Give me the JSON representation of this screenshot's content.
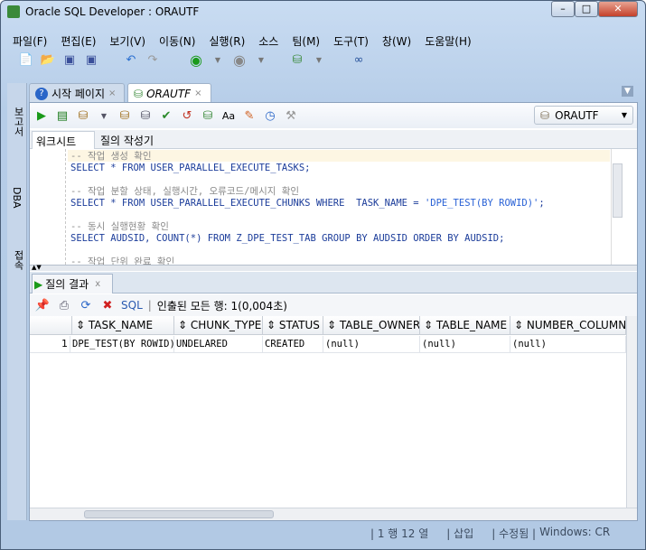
{
  "window": {
    "title": "Oracle SQL Developer : ORAUTF",
    "min": "–",
    "max": "□",
    "close": "✕"
  },
  "menu": [
    "파일(F)",
    "편집(E)",
    "보기(V)",
    "이동(N)",
    "실행(R)",
    "소스",
    "팀(M)",
    "도구(T)",
    "창(W)",
    "도움말(H)"
  ],
  "rail": {
    "reports": "보고서",
    "dba": "DBA",
    "connections": "접속"
  },
  "tabs": [
    {
      "label": "시작 페이지",
      "close": "×"
    },
    {
      "label": "ORAUTF",
      "close": "×"
    }
  ],
  "connection_select": "ORAUTF",
  "worksheet_tabs": [
    "워크시트",
    "질의 작성기"
  ],
  "editor_lines": [
    {
      "type": "comment",
      "text": "-- 작업 생성 확인"
    },
    {
      "type": "code",
      "text": "SELECT * FROM USER_PARALLEL_EXECUTE_TASKS;"
    },
    {
      "type": "code",
      "text": ""
    },
    {
      "type": "comment",
      "text": "-- 작업 분할 상태, 실행시간, 오류코드/메시지 확인"
    },
    {
      "type": "code",
      "text": "SELECT * FROM USER_PARALLEL_EXECUTE_CHUNKS WHERE  TASK_NAME = ",
      "str": "'DPE_TEST(BY ROWID)'",
      "tail": ";"
    },
    {
      "type": "code",
      "text": ""
    },
    {
      "type": "comment",
      "text": "-- 동시 실행현황 확인"
    },
    {
      "type": "code",
      "text": "SELECT AUDSID, COUNT(*) FROM Z_DPE_TEST_TAB GROUP BY AUDSID ORDER BY AUDSID;"
    },
    {
      "type": "code",
      "text": ""
    },
    {
      "type": "comment",
      "text": "-- 작업 단위 완료 확인"
    }
  ],
  "results": {
    "tab_label": "질의 결과",
    "tab_close": "x",
    "sql_label": "SQL",
    "separator": "|",
    "fetched": "인출된 모든 행: 1(0,004초)",
    "columns": [
      "TASK_NAME",
      "CHUNK_TYPE",
      "STATUS",
      "TABLE_OWNER",
      "TABLE_NAME",
      "NUMBER_COLUMN"
    ],
    "rows": [
      {
        "num": "1",
        "cells": [
          "DPE_TEST(BY ROWID)",
          "UNDELARED",
          "CREATED",
          "(null)",
          "(null)",
          "(null)"
        ]
      }
    ]
  },
  "status": {
    "position": "| 1 행 12 열",
    "mode": "| 삽입",
    "modified": "| 수정됨 |",
    "eol": "Windows: CR"
  }
}
